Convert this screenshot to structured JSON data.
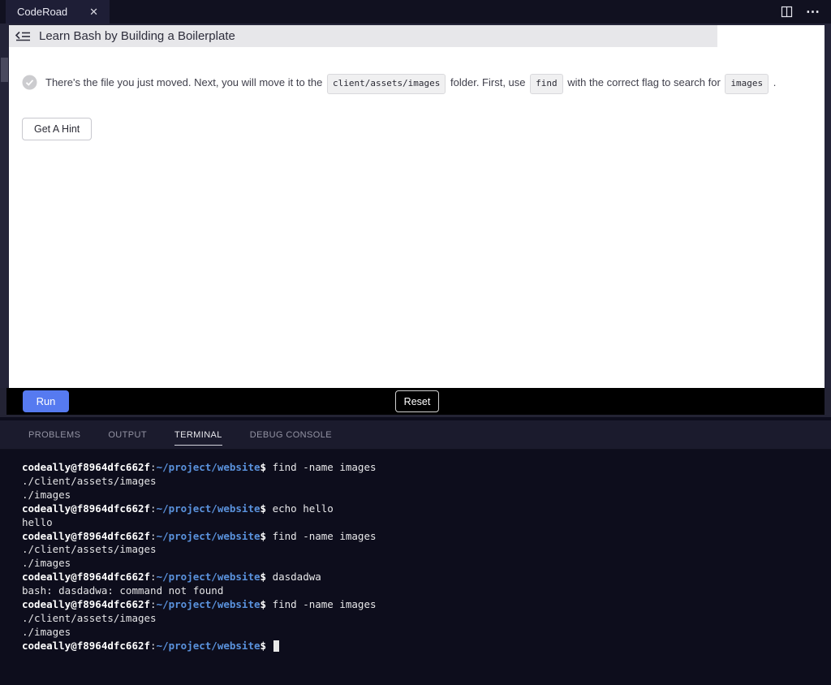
{
  "window": {
    "tab": {
      "title": "CodeRoad"
    },
    "icons": {
      "close_glyph": "✕",
      "more_glyph": "⋯",
      "split_editor": "split-editor-icon"
    }
  },
  "coderoad": {
    "header": {
      "title": "Learn Bash by Building a Boilerplate"
    },
    "task": {
      "segments": [
        {
          "type": "text",
          "value": "There's the file you just moved. Next, you will move it to the "
        },
        {
          "type": "code",
          "value": "client/assets/images"
        },
        {
          "type": "text",
          "value": " folder. First, use "
        },
        {
          "type": "code",
          "value": "find"
        },
        {
          "type": "text",
          "value": " with the correct flag to search for "
        },
        {
          "type": "code",
          "value": "images"
        },
        {
          "type": "text",
          "value": " ."
        }
      ]
    },
    "hint_button": "Get A Hint",
    "run_button": "Run",
    "reset_button": "Reset"
  },
  "panel": {
    "tabs": [
      {
        "label": "PROBLEMS",
        "active": false
      },
      {
        "label": "OUTPUT",
        "active": false
      },
      {
        "label": "TERMINAL",
        "active": true
      },
      {
        "label": "DEBUG CONSOLE",
        "active": false
      }
    ]
  },
  "terminal": {
    "prompt": {
      "user_host": "codeally@f8964dfc662f",
      "colon": ":",
      "path": "~/project/website",
      "dollar": "$"
    },
    "lines": [
      {
        "type": "prompt",
        "command": "find -name images"
      },
      {
        "type": "output",
        "text": "./client/assets/images"
      },
      {
        "type": "output",
        "text": "./images"
      },
      {
        "type": "prompt",
        "command": "echo hello"
      },
      {
        "type": "output",
        "text": "hello"
      },
      {
        "type": "prompt",
        "command": "find -name images"
      },
      {
        "type": "output",
        "text": "./client/assets/images"
      },
      {
        "type": "output",
        "text": "./images"
      },
      {
        "type": "prompt",
        "command": "dasdadwa"
      },
      {
        "type": "output",
        "text": "bash: dasdadwa: command not found"
      },
      {
        "type": "prompt",
        "command": "find -name images"
      },
      {
        "type": "output",
        "text": "./client/assets/images"
      },
      {
        "type": "output",
        "text": "./images"
      },
      {
        "type": "prompt",
        "command": "",
        "cursor": true
      }
    ]
  },
  "colors": {
    "accent_blue": "#567af0",
    "terminal_path_blue": "#5a92dd",
    "panel_bg": "#0d0d1c",
    "header_bg": "#e7e7ea"
  }
}
